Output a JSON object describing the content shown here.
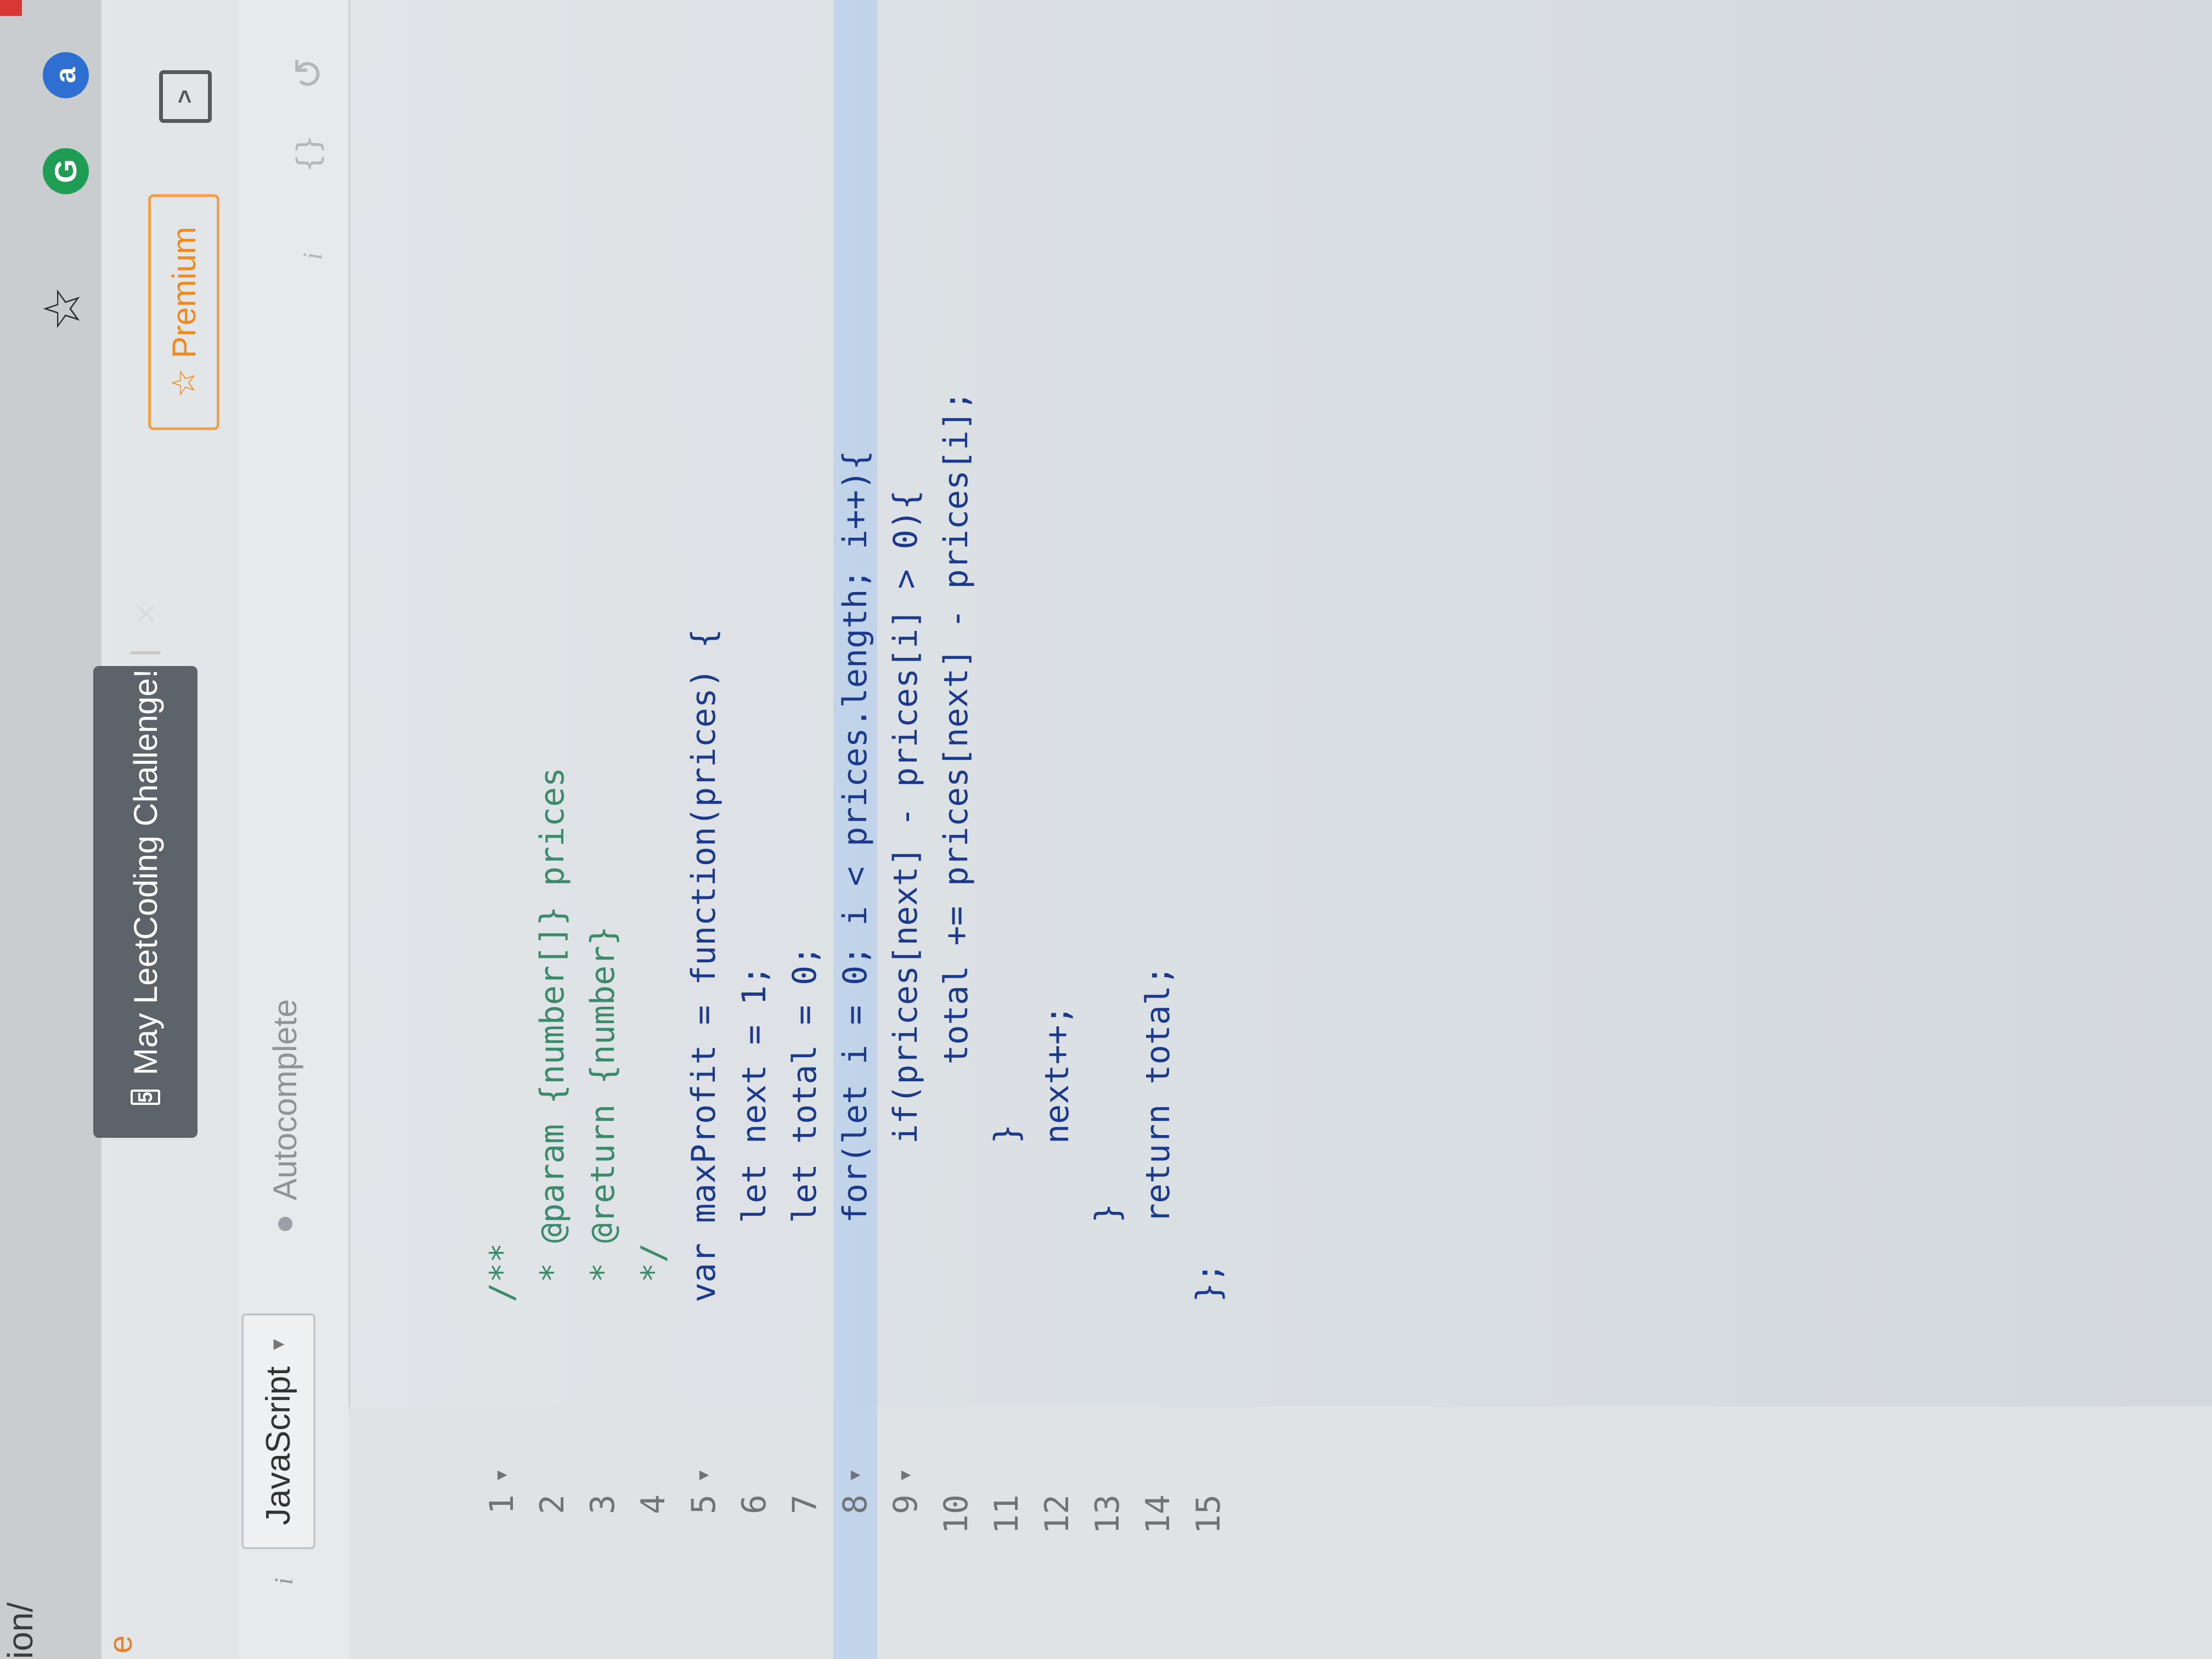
{
  "browser": {
    "url_tail": "ion/",
    "extensions": [
      "G",
      "a"
    ]
  },
  "header": {
    "challenge_number": "5",
    "challenge_label": "May LeetCoding Challenge!",
    "close_symbol": "×",
    "premium_label": "Premium",
    "tab_partial": "e"
  },
  "toolbar": {
    "language": "JavaScript",
    "autocomplete_label": "Autocomplete"
  },
  "editor": {
    "lines": [
      {
        "num": "1",
        "fold": true,
        "text": "/**"
      },
      {
        "num": "2",
        "fold": false,
        "text": " * @param {number[]} prices"
      },
      {
        "num": "3",
        "fold": false,
        "text": " * @return {number}"
      },
      {
        "num": "4",
        "fold": false,
        "text": " */"
      },
      {
        "num": "5",
        "fold": true,
        "text": "var maxProfit = function(prices) {"
      },
      {
        "num": "6",
        "fold": false,
        "text": "    let next = 1;"
      },
      {
        "num": "7",
        "fold": false,
        "text": "    let total = 0;"
      },
      {
        "num": "8",
        "fold": true,
        "text": "    for(let i = 0; i < prices.length; i++){"
      },
      {
        "num": "9",
        "fold": true,
        "text": "        if(prices[next] - prices[i] > 0){"
      },
      {
        "num": "10",
        "fold": false,
        "text": "            total += prices[next] - prices[i];"
      },
      {
        "num": "11",
        "fold": false,
        "text": "        }"
      },
      {
        "num": "12",
        "fold": false,
        "text": "        next++;"
      },
      {
        "num": "13",
        "fold": false,
        "text": "    }"
      },
      {
        "num": "14",
        "fold": false,
        "text": "    return total;"
      },
      {
        "num": "15",
        "fold": false,
        "text": "};"
      }
    ],
    "highlighted_line": "8"
  }
}
